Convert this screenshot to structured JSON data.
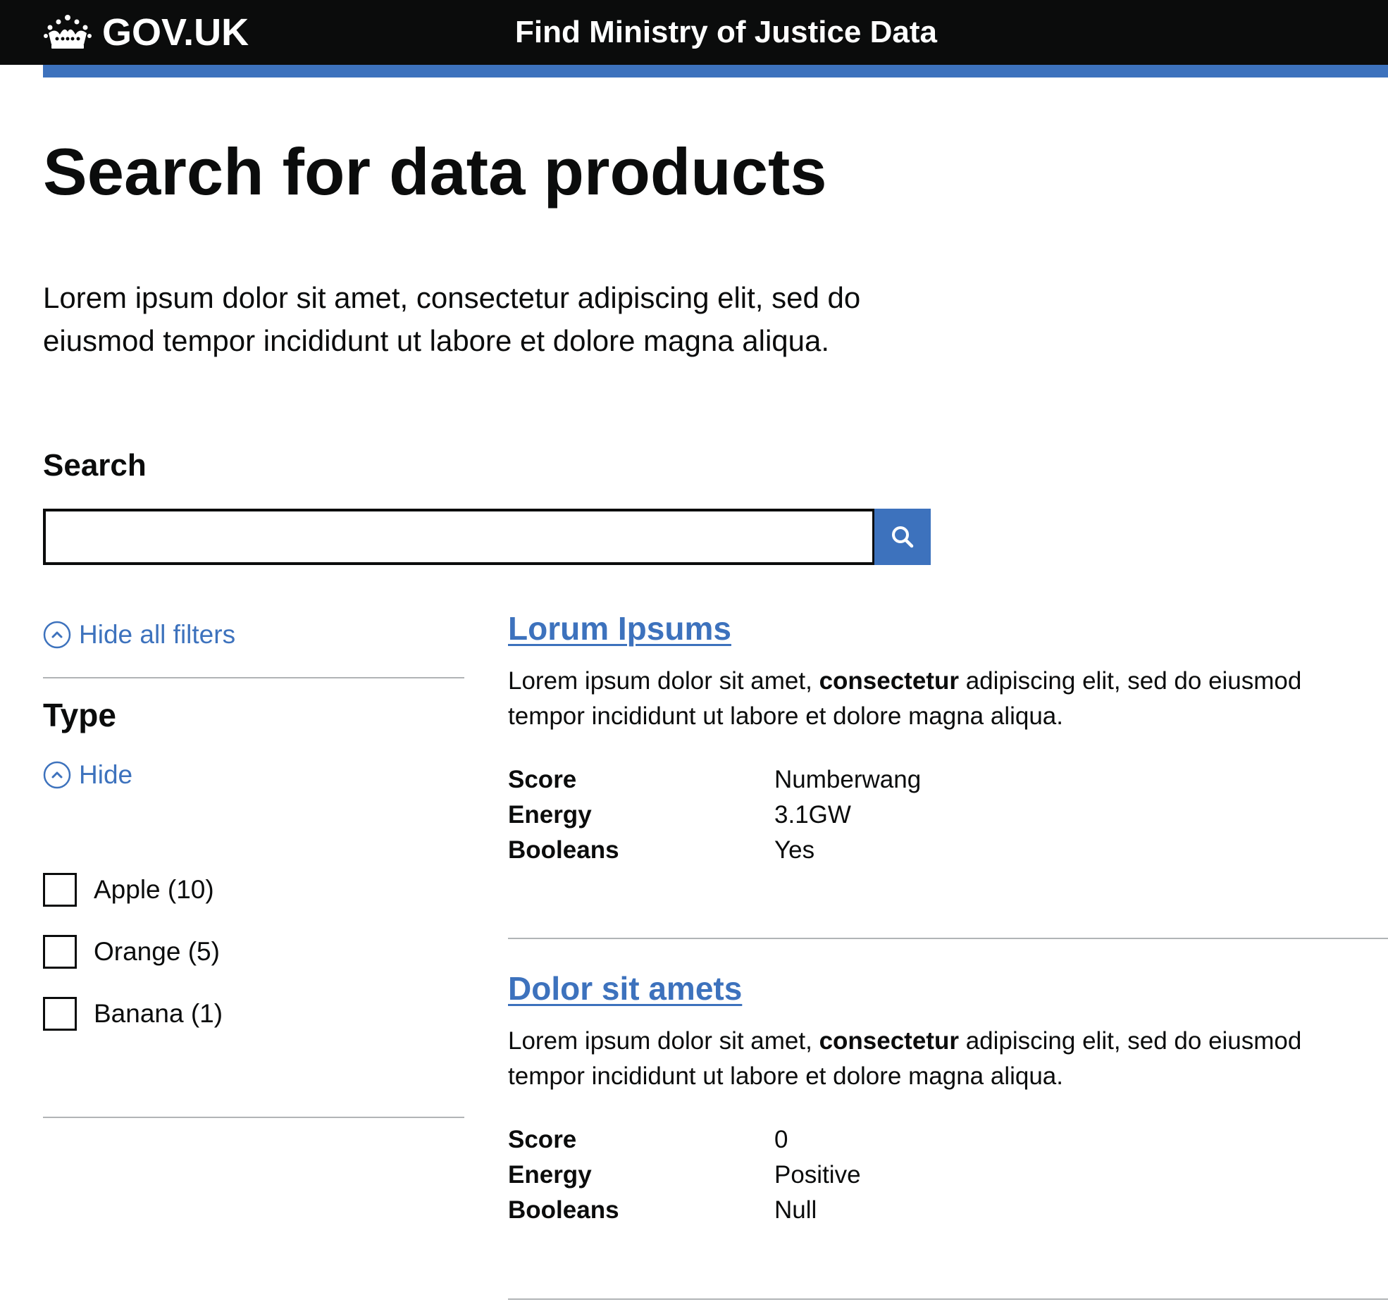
{
  "header": {
    "logo_text": "GOV.UK",
    "service_name": "Find Ministry of Justice Data",
    "crown_icon": "crown-icon",
    "stripe_color": "#3d72bd"
  },
  "main": {
    "title": "Search for data products",
    "lead": "Lorem ipsum dolor sit amet, consectetur adipiscing elit, sed do eiusmod tempor incididunt ut labore et dolore magna aliqua."
  },
  "search": {
    "label": "Search",
    "value": "",
    "placeholder": "",
    "button_icon": "search-icon"
  },
  "filters": {
    "hide_all_label": "Hide all filters",
    "type": {
      "heading": "Type",
      "hide_label": "Hide",
      "options": [
        {
          "label": "Apple (10)",
          "checked": false
        },
        {
          "label": "Orange (5)",
          "checked": false
        },
        {
          "label": "Banana (1)",
          "checked": false
        }
      ]
    }
  },
  "results": [
    {
      "title": "Lorum Ipsums",
      "desc_before": "Lorem ipsum dolor sit amet, ",
      "desc_bold": "consectetur",
      "desc_after": " adipiscing elit, sed do eiusmod tempor incididunt ut labore et dolore magna aliqua.",
      "meta": [
        {
          "key": "Score",
          "value": "Numberwang"
        },
        {
          "key": "Energy",
          "value": "3.1GW"
        },
        {
          "key": "Booleans",
          "value": "Yes"
        }
      ]
    },
    {
      "title": "Dolor sit amets",
      "desc_before": "Lorem ipsum dolor sit amet, ",
      "desc_bold": "consectetur",
      "desc_after": " adipiscing elit, sed do eiusmod tempor incididunt ut labore et dolore magna aliqua.",
      "meta": [
        {
          "key": "Score",
          "value": "0"
        },
        {
          "key": "Energy",
          "value": "Positive"
        },
        {
          "key": "Booleans",
          "value": "Null"
        }
      ]
    }
  ]
}
